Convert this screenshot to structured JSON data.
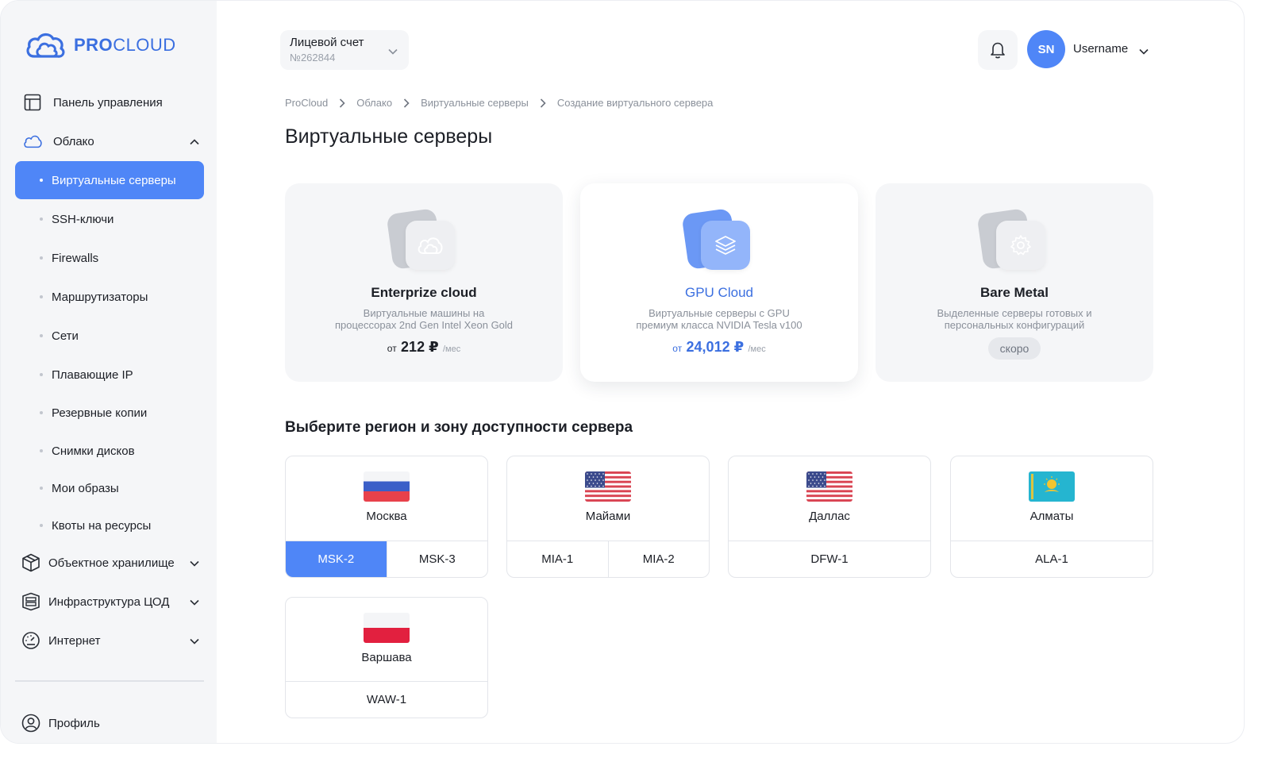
{
  "brand": {
    "name_bold": "PRO",
    "name_light": "CLOUD"
  },
  "sidebar": {
    "items": [
      {
        "label": "Панель управления"
      },
      {
        "label": "Облако"
      },
      {
        "label": "Объектное хранилище"
      },
      {
        "label": "Инфраструктура ЦОД"
      },
      {
        "label": "Интернет"
      },
      {
        "label": "Профиль"
      }
    ],
    "cloud_sub": [
      {
        "label": "Виртуальные серверы",
        "active": true
      },
      {
        "label": "SSH-ключи"
      },
      {
        "label": "Firewalls"
      },
      {
        "label": "Маршрутизаторы"
      },
      {
        "label": "Сети"
      },
      {
        "label": "Плавающие IP"
      },
      {
        "label": "Резервные копии"
      },
      {
        "label": "Снимки дисков"
      },
      {
        "label": "Мои образы"
      },
      {
        "label": "Квоты на ресурсы"
      }
    ]
  },
  "header": {
    "account_label": "Лицевой счет",
    "account_number": "№262844",
    "avatar_initials": "SN",
    "username": "Username"
  },
  "breadcrumb": [
    "ProCloud",
    "Облако",
    "Виртуальные серверы",
    "Создание виртуального сервера"
  ],
  "page_title": "Виртуальные серверы",
  "products": [
    {
      "name": "Enterprize cloud",
      "desc1": "Виртуальные машины на",
      "desc2": "процессорах 2nd Gen Intel Xeon Gold",
      "price_prefix": "от",
      "price": "212 ₽",
      "price_unit": "/мес"
    },
    {
      "name": "GPU Cloud",
      "desc1": "Виртуальные серверы с GPU",
      "desc2": "премиум класса NVIDIA Tesla v100",
      "price_prefix": "от",
      "price": "24,012 ₽",
      "price_unit": "/мес",
      "selected": true
    },
    {
      "name": "Bare Metal",
      "desc1": "Выделенные серверы готовых и",
      "desc2": "персональных конфигураций",
      "badge": "скоро"
    }
  ],
  "region_title": "Выберите регион и зону доступности сервера",
  "regions": [
    {
      "city": "Москва",
      "zones": [
        "MSK-2",
        "MSK-3"
      ],
      "active_zone": "MSK-2"
    },
    {
      "city": "Майами",
      "zones": [
        "MIA-1",
        "MIA-2"
      ]
    },
    {
      "city": "Даллас",
      "zones": [
        "DFW-1"
      ]
    },
    {
      "city": "Алматы",
      "zones": [
        "ALA-1"
      ]
    },
    {
      "city": "Варшава",
      "zones": [
        "WAW-1"
      ]
    }
  ],
  "colors": {
    "accent": "#4f86f7",
    "brand": "#3b6fe0",
    "sidebar_bg": "#f5f6f8"
  }
}
